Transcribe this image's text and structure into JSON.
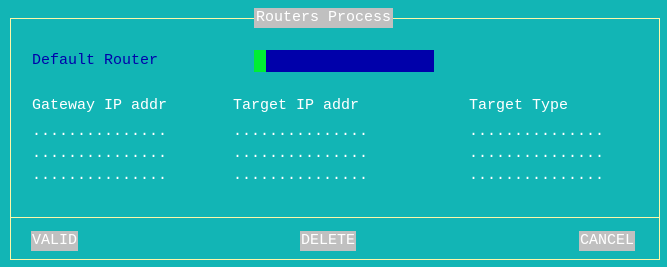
{
  "dialog": {
    "title": "Routers Process"
  },
  "default_router": {
    "label": "Default Router",
    "value": ""
  },
  "table": {
    "columns": [
      "Gateway IP addr",
      "Target IP addr",
      "Target Type"
    ],
    "rows": [
      [
        "...............",
        "...............",
        "..............."
      ],
      [
        "...............",
        "...............",
        "..............."
      ],
      [
        "...............",
        "...............",
        "..............."
      ]
    ]
  },
  "buttons": {
    "valid": "VALID",
    "delete": "DELETE",
    "cancel": "CANCEL"
  },
  "colors": {
    "background": "#12b5b5",
    "frame": "#fdf7a8",
    "input_background": "#0000aa",
    "input_cursor": "#00ee33",
    "label_text": "#0000aa",
    "button_background": "#c0c0c0"
  }
}
